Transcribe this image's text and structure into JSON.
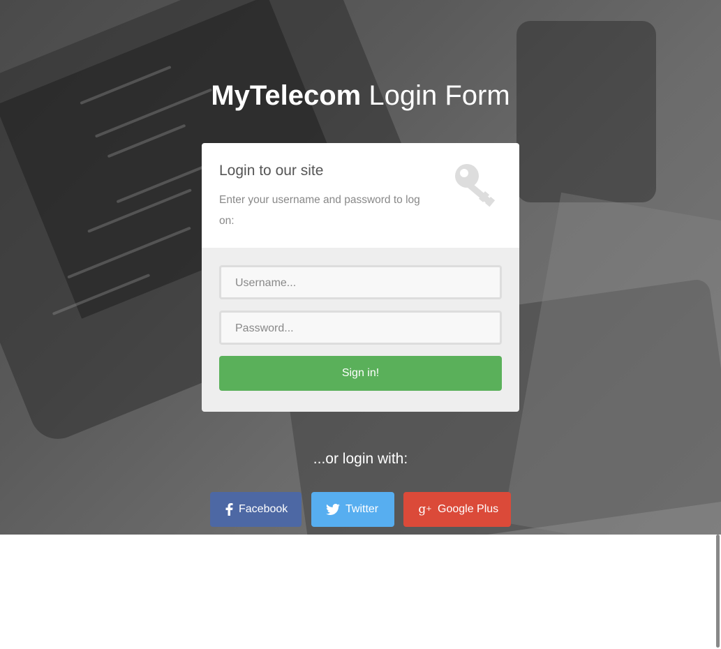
{
  "page": {
    "title_bold": "MyTelecom",
    "title_light": "Login Form"
  },
  "card": {
    "heading": "Login to our site",
    "subtext": "Enter your username and password to log on:",
    "icon": "key-icon"
  },
  "form": {
    "username_placeholder": "Username...",
    "password_placeholder": "Password...",
    "submit_label": "Sign in!"
  },
  "social": {
    "prompt": "...or login with:",
    "buttons": [
      {
        "label": "Facebook",
        "icon": "facebook-icon",
        "color": "#4d68a4"
      },
      {
        "label": "Twitter",
        "icon": "twitter-icon",
        "color": "#57aef0"
      },
      {
        "label": "Google Plus",
        "icon": "google-plus-icon",
        "color": "#db4a39"
      }
    ]
  },
  "colors": {
    "submit": "#5ab05a",
    "card_bottom": "#eeeeee"
  }
}
